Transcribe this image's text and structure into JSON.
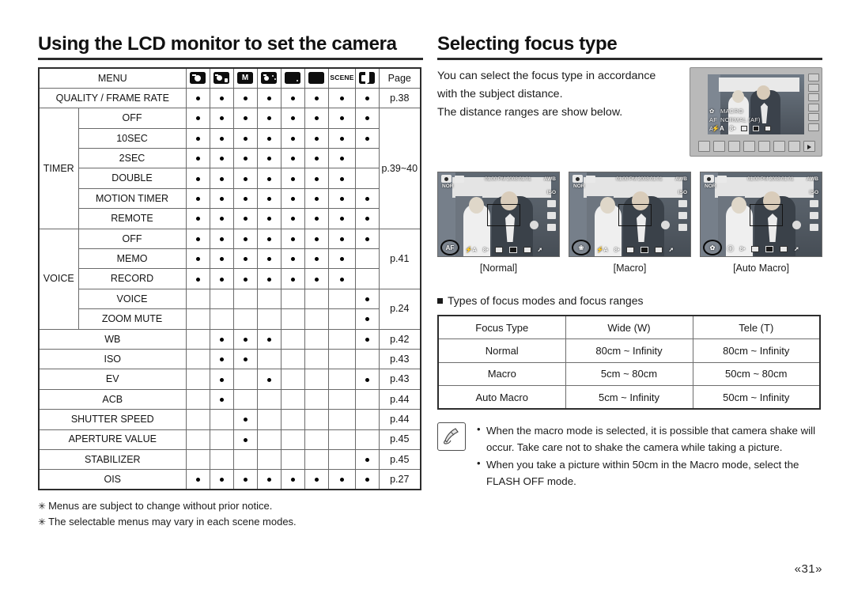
{
  "left": {
    "heading": "Using the LCD monitor to set the camera",
    "table": {
      "header": {
        "menu_label": "MENU",
        "page_label": "Page",
        "mode_icons": [
          "auto-mode-icon",
          "program-mode-icon",
          "manual-mode-icon",
          "dis-mode-icon",
          "night-mode-icon",
          "beauty-shot-mode-icon",
          "scene-mode-icon",
          "movie-mode-icon"
        ],
        "scene_text": "SCENE",
        "manual_text": "M"
      },
      "rows": [
        {
          "group": "",
          "label": "QUALITY / FRAME RATE",
          "span": 2,
          "dots": [
            1,
            1,
            1,
            1,
            1,
            1,
            1,
            1
          ],
          "page": "p.38",
          "page_rowspan": 1
        },
        {
          "group": "TIMER",
          "group_rowspan": 6,
          "label": "OFF",
          "dots": [
            1,
            1,
            1,
            1,
            1,
            1,
            1,
            1
          ],
          "page": "p.39~40",
          "page_rowspan": 6
        },
        {
          "label": "10SEC",
          "dots": [
            1,
            1,
            1,
            1,
            1,
            1,
            1,
            1
          ]
        },
        {
          "label": "2SEC",
          "dots": [
            1,
            1,
            1,
            1,
            1,
            1,
            1,
            0
          ]
        },
        {
          "label": "DOUBLE",
          "dots": [
            1,
            1,
            1,
            1,
            1,
            1,
            1,
            0
          ]
        },
        {
          "label": "MOTION TIMER",
          "dots": [
            1,
            1,
            1,
            1,
            1,
            1,
            1,
            1
          ]
        },
        {
          "label": "REMOTE",
          "dots": [
            1,
            1,
            1,
            1,
            1,
            1,
            1,
            1
          ]
        },
        {
          "group": "VOICE",
          "group_rowspan": 5,
          "label": "OFF",
          "dots": [
            1,
            1,
            1,
            1,
            1,
            1,
            1,
            1
          ],
          "page": "p.41",
          "page_rowspan": 3
        },
        {
          "label": "MEMO",
          "dots": [
            1,
            1,
            1,
            1,
            1,
            1,
            1,
            0
          ]
        },
        {
          "label": "RECORD",
          "dots": [
            1,
            1,
            1,
            1,
            1,
            1,
            1,
            0
          ]
        },
        {
          "label": "VOICE",
          "dots": [
            0,
            0,
            0,
            0,
            0,
            0,
            0,
            1
          ],
          "page": "p.24",
          "page_rowspan": 2
        },
        {
          "label": "ZOOM MUTE",
          "dots": [
            0,
            0,
            0,
            0,
            0,
            0,
            0,
            1
          ]
        },
        {
          "label": "WB",
          "span": 2,
          "dots": [
            0,
            1,
            1,
            1,
            0,
            0,
            0,
            1
          ],
          "page": "p.42",
          "page_rowspan": 1
        },
        {
          "label": "ISO",
          "span": 2,
          "dots": [
            0,
            1,
            1,
            0,
            0,
            0,
            0,
            0
          ],
          "page": "p.43",
          "page_rowspan": 1
        },
        {
          "label": "EV",
          "span": 2,
          "dots": [
            0,
            1,
            0,
            1,
            0,
            0,
            0,
            1
          ],
          "page": "p.43",
          "page_rowspan": 1
        },
        {
          "label": "ACB",
          "span": 2,
          "dots": [
            0,
            1,
            0,
            0,
            0,
            0,
            0,
            0
          ],
          "page": "p.44",
          "page_rowspan": 1
        },
        {
          "label": "SHUTTER SPEED",
          "span": 2,
          "dots": [
            0,
            0,
            1,
            0,
            0,
            0,
            0,
            0
          ],
          "page": "p.44",
          "page_rowspan": 1
        },
        {
          "label": "APERTURE VALUE",
          "span": 2,
          "dots": [
            0,
            0,
            1,
            0,
            0,
            0,
            0,
            0
          ],
          "page": "p.45",
          "page_rowspan": 1
        },
        {
          "label": "STABILIZER",
          "span": 2,
          "dots": [
            0,
            0,
            0,
            0,
            0,
            0,
            0,
            1
          ],
          "page": "p.45",
          "page_rowspan": 1
        },
        {
          "label": "OIS",
          "span": 2,
          "dots": [
            1,
            1,
            1,
            1,
            1,
            1,
            1,
            1
          ],
          "page": "p.27",
          "page_rowspan": 1
        }
      ]
    },
    "footnotes": [
      "Menus are subject to change without prior notice.",
      "The selectable menus may vary in each scene modes."
    ],
    "footnote_marker": "✳"
  },
  "right": {
    "heading": "Selecting focus type",
    "intro_lines": [
      "You can select the focus type in accordance",
      "with the subject distance.",
      "The distance ranges are show below."
    ],
    "camera_lcd": {
      "macro_label": "MACRO",
      "normal_label": "NORMAL (AF)",
      "af_label_1": "AF",
      "af_label_2": "AF",
      "flash_glyph": "⚡A",
      "number_glyph": "8•"
    },
    "thumbnails": [
      {
        "caption": "[Normal]",
        "badge": "AF",
        "datetime": "01:00 PM 2008.01.01",
        "awb": "AWB",
        "nor": "NOR",
        "iso": "ISO",
        "flash": "⚡A",
        "count": "8•"
      },
      {
        "caption": "[Macro]",
        "badge": "❀",
        "datetime": "01:00 PM 2008.01.01",
        "awb": "AWB",
        "nor": "NOR",
        "iso": "ISO",
        "flash": "⚡A",
        "count": "8•"
      },
      {
        "caption": "[Auto Macro]",
        "badge": "✿",
        "datetime": "01:00 PM 2008.01.01",
        "awb": "AWB",
        "nor": "NOR",
        "iso": "ISO",
        "flash": "ⓘ",
        "count": "8•"
      }
    ],
    "focus_section_title": "Types of focus modes and focus ranges",
    "focus_table": {
      "headers": [
        "Focus Type",
        "Wide (W)",
        "Tele (T)"
      ],
      "rows": [
        [
          "Normal",
          "80cm ~ Infinity",
          "80cm ~ Infinity"
        ],
        [
          "Macro",
          "5cm ~ 80cm",
          "50cm ~ 80cm"
        ],
        [
          "Auto Macro",
          "5cm ~ Infinity",
          "50cm ~ Infinity"
        ]
      ]
    },
    "notes": [
      "When the macro mode is selected, it is possible that camera shake will occur. Take care not to shake the camera while taking a picture.",
      "When you take a picture within 50cm in the Macro mode, select the FLASH OFF mode."
    ]
  },
  "page_number": "«31»"
}
